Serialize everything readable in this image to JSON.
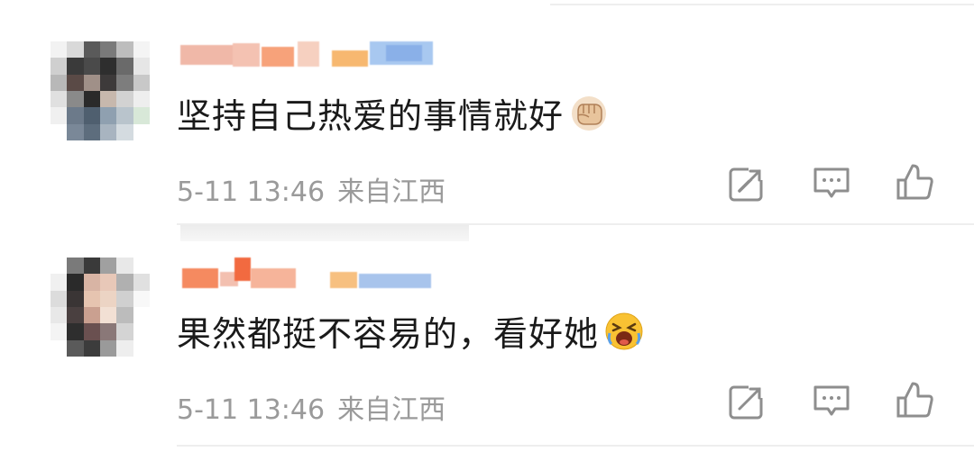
{
  "comments": [
    {
      "text": "坚持自己热爱的事情就好",
      "emoji_icon": "fist-emoji-icon",
      "date": "5-11 13:46",
      "location": "来自江西",
      "actions": {
        "repost_icon": "repost-icon",
        "reply_icon": "comment-icon",
        "like_icon": "thumbs-up-icon"
      }
    },
    {
      "text": "果然都挺不容易的，看好她",
      "emoji_icon": "crying-face-emoji-icon",
      "date": "5-11 13:46",
      "location": "来自江西",
      "actions": {
        "repost_icon": "repost-icon",
        "reply_icon": "comment-icon",
        "like_icon": "thumbs-up-icon"
      }
    }
  ],
  "colors": {
    "text": "#1a1a1a",
    "meta": "#9a9a9a",
    "icon": "#8e8e8e",
    "divider": "#eeeeee"
  }
}
